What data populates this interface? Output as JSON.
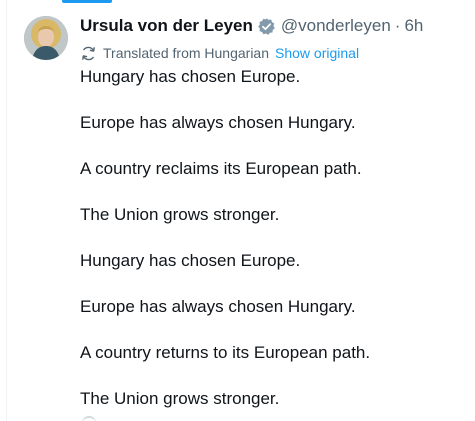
{
  "tweet": {
    "author": {
      "display_name": "Ursula von der Leyen",
      "handle": "@vonderleyen",
      "separator": "·",
      "time": "6h",
      "verified": true,
      "verified_color": "#829aab",
      "avatar_icon": "profile-photo"
    },
    "translation": {
      "icon": "translate-icon",
      "label": "Translated from Hungarian",
      "show_original": "Show original",
      "link_color": "#1d9bf0"
    },
    "lines": [
      "Hungary has chosen Europe.",
      "Europe has always chosen Hungary.",
      "A country reclaims its European path.",
      "The Union grows stronger.",
      "Hungary has chosen Europe.",
      "Europe has always chosen Hungary.",
      "A country returns to its European path.",
      "The Union grows stronger."
    ]
  }
}
